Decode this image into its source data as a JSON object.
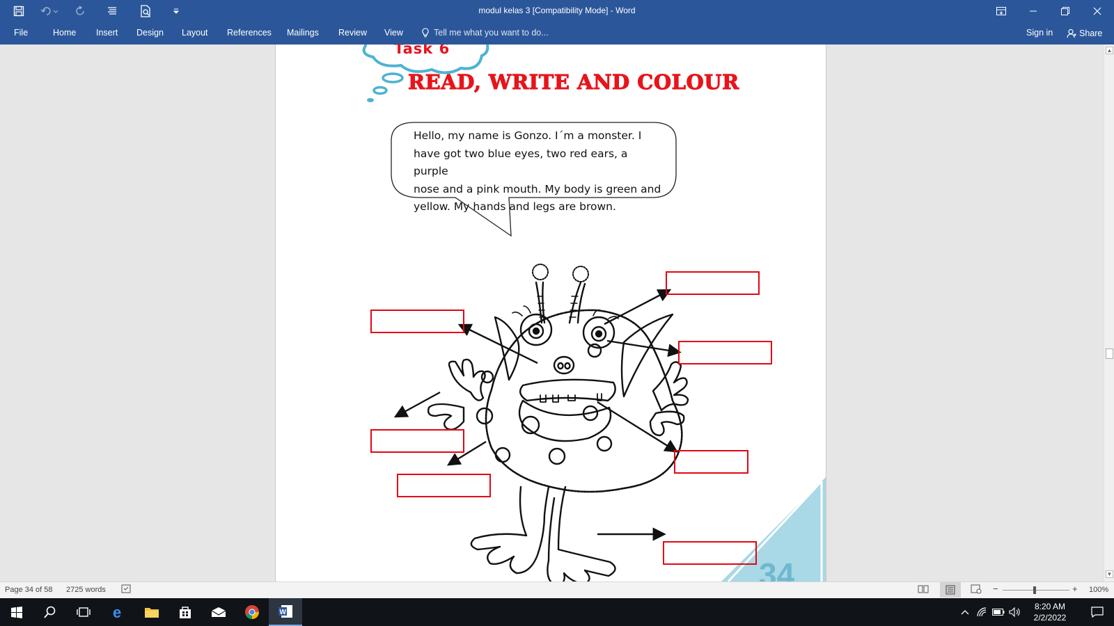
{
  "window": {
    "title": "modul kelas 3 [Compatibility Mode] - Word"
  },
  "ribbon": {
    "tabs": [
      "File",
      "Home",
      "Insert",
      "Design",
      "Layout",
      "References",
      "Mailings",
      "Review",
      "View"
    ],
    "tell_me": "Tell me what you want to do...",
    "sign_in": "Sign in",
    "share": "Share"
  },
  "document": {
    "task_label": "Task 6",
    "heading": "READ, WRITE AND COLOUR",
    "bubble_lines": [
      "Hello, my name is Gonzo. I´m a monster. I",
      "have got two blue eyes, two red ears, a purple",
      "nose and a pink mouth. My body is green and",
      "yellow. My hands and legs are brown."
    ],
    "answer_boxes": [
      {
        "id": "ear-right",
        "value": ""
      },
      {
        "id": "nose",
        "value": ""
      },
      {
        "id": "eye",
        "value": ""
      },
      {
        "id": "hand",
        "value": ""
      },
      {
        "id": "mouth",
        "value": ""
      },
      {
        "id": "body",
        "value": ""
      },
      {
        "id": "foot",
        "value": ""
      }
    ],
    "page_corner_number": "34"
  },
  "status": {
    "page": "Page 34 of 58",
    "words": "2725 words",
    "zoom": "100%"
  },
  "taskbar": {
    "time": "8:20 AM",
    "date": "2/2/2022"
  },
  "colors": {
    "word_blue": "#2b579a",
    "heading_red": "#e8141b",
    "cloud_blue": "#4db3d1",
    "box_red": "#e30613",
    "corner_blue": "#a9d8e6"
  }
}
